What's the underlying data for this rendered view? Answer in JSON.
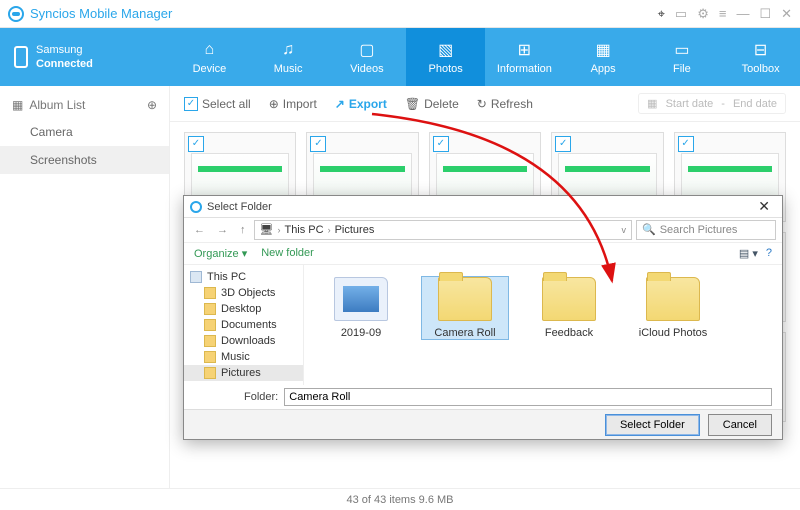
{
  "app": {
    "title": "Syncios Mobile Manager"
  },
  "device": {
    "brand": "Samsung",
    "status": "Connected"
  },
  "nav": {
    "items": [
      {
        "label": "Device",
        "icon": "⌂"
      },
      {
        "label": "Music",
        "icon": "♫"
      },
      {
        "label": "Videos",
        "icon": "▢"
      },
      {
        "label": "Photos",
        "icon": "▧"
      },
      {
        "label": "Information",
        "icon": "⊞"
      },
      {
        "label": "Apps",
        "icon": "▦"
      },
      {
        "label": "File",
        "icon": "▭"
      },
      {
        "label": "Toolbox",
        "icon": "⊟"
      }
    ],
    "active": 3
  },
  "sidebar": {
    "header": "Album List",
    "add_icon": "⊕",
    "items": [
      {
        "label": "Camera",
        "icon": "📷"
      },
      {
        "label": "Screenshots",
        "icon": "▤"
      }
    ],
    "active": 1
  },
  "toolbar": {
    "select_all": "Select all",
    "import": "Import",
    "export": "Export",
    "delete": "Delete",
    "refresh": "Refresh",
    "start_date": "Start date",
    "end_date": "End date",
    "date_sep": "-"
  },
  "status": {
    "text": "43 of 43 items 9.6 MB"
  },
  "dialog": {
    "title": "Select Folder",
    "path_segments": [
      "This PC",
      "Pictures"
    ],
    "search_placeholder": "Search Pictures",
    "organize": "Organize",
    "new_folder": "New folder",
    "tree": [
      {
        "label": "This PC",
        "kind": "pc",
        "level": 1
      },
      {
        "label": "3D Objects",
        "kind": "f",
        "level": 2
      },
      {
        "label": "Desktop",
        "kind": "f",
        "level": 2
      },
      {
        "label": "Documents",
        "kind": "f",
        "level": 2
      },
      {
        "label": "Downloads",
        "kind": "f",
        "level": 2
      },
      {
        "label": "Music",
        "kind": "f",
        "level": 2
      },
      {
        "label": "Pictures",
        "kind": "f",
        "level": 2,
        "selected": true
      }
    ],
    "files": [
      {
        "label": "2019-09",
        "kind": "pic"
      },
      {
        "label": "Camera Roll",
        "kind": "folder",
        "selected": true
      },
      {
        "label": "Feedback",
        "kind": "folder"
      },
      {
        "label": "iCloud Photos",
        "kind": "folder"
      }
    ],
    "folder_label": "Folder:",
    "folder_value": "Camera Roll",
    "select_btn": "Select Folder",
    "cancel_btn": "Cancel"
  }
}
